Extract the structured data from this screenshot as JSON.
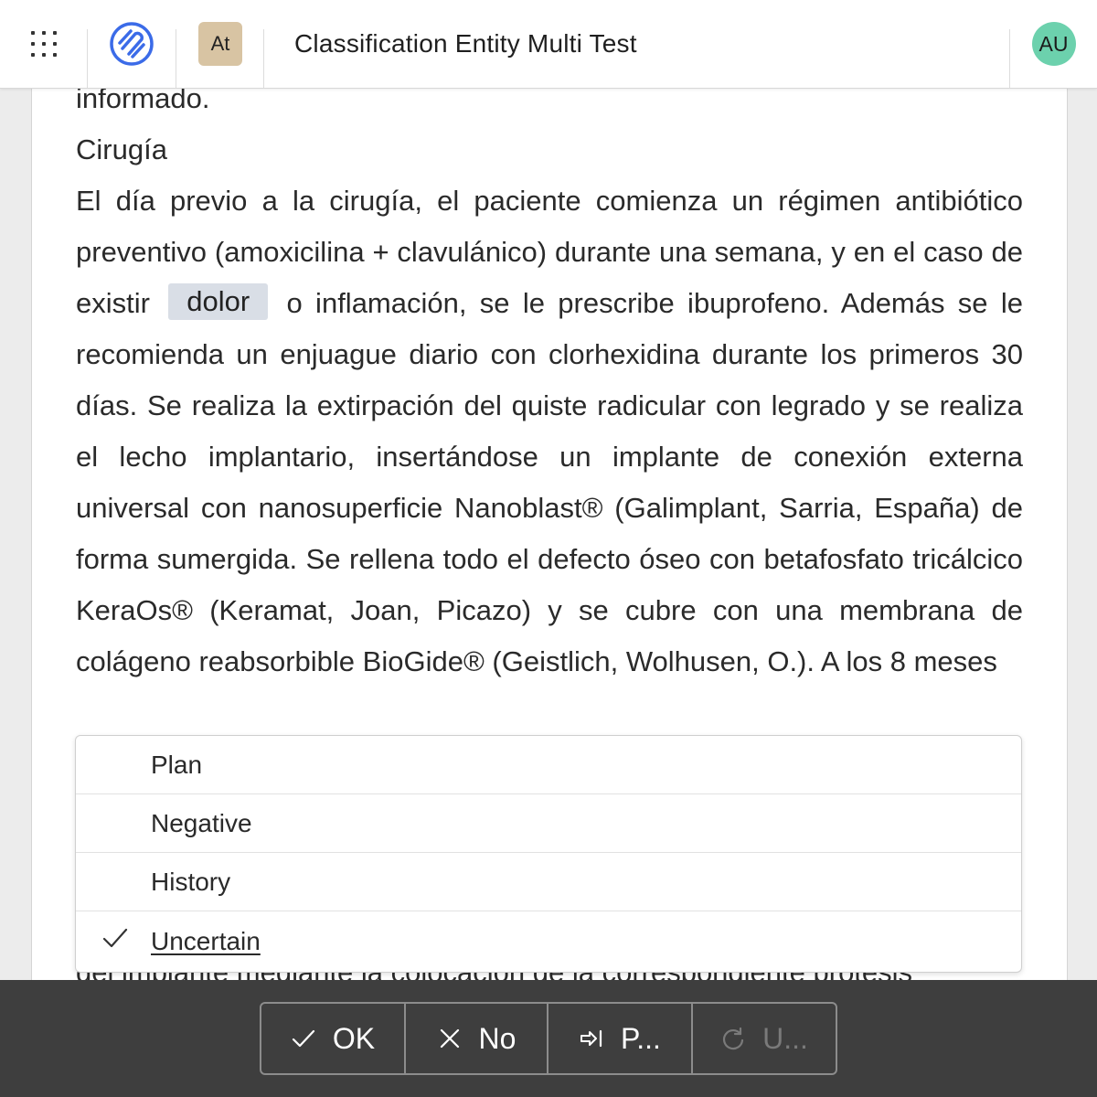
{
  "app": {
    "title": "Classification Entity Multi Test",
    "project_badge": "At",
    "user_initials": "AU",
    "colors": {
      "badge": "#d8c4a3",
      "avatar": "#6cd1ad",
      "logo": "#3b6be8",
      "toolbar": "#3e3e3e"
    }
  },
  "document": {
    "partial_top_line": "informado.",
    "heading": "Cirugía",
    "para_before": "El día previo a la cirugía, el paciente comienza un régimen antibiótico preventivo (amoxicilina + clavulánico) durante una semana, y en el caso de existir",
    "entity": "dolor",
    "para_after": "o inflamación, se le prescribe ibuprofeno. Además se le recomienda un enjuague diario con clorhexidina durante los primeros 30 días. Se realiza la extirpación del quiste radicular con legrado y se realiza el lecho implantario, insertándose un implante de conexión externa universal con nanosuperficie Nanoblast® (Galimplant, Sarria, España) de forma sumergida. Se rellena todo el defecto óseo con betafosfato tricálcico KeraOs® (Keramat, Joan, Picazo) y se cubre con una membrana de colágeno reabsorbible BioGide® (Geistlich, Wolhusen, O.). A los 8 meses",
    "cutoff_line": "del implante mediante la colocación de la correspondiente prótesis"
  },
  "dropdown": {
    "items": [
      {
        "label": "Plan",
        "selected": false
      },
      {
        "label": "Negative",
        "selected": false
      },
      {
        "label": "History",
        "selected": false
      },
      {
        "label": "Uncertain",
        "selected": true
      }
    ]
  },
  "toolbar": {
    "ok_label": "OK",
    "no_label": "No",
    "next_label": "P...",
    "undo_label": "U..."
  }
}
